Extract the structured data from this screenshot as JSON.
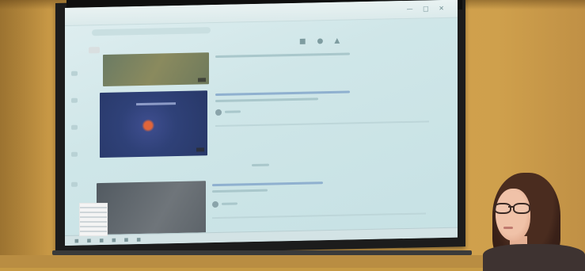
{
  "scene": {
    "description_colors": {
      "wall": "#c69a45",
      "screen_bg": "#cfe6e8",
      "frame": "#1c1c1c",
      "accent_title": "#5d7ea2"
    }
  },
  "browser": {
    "toolbar_icons": [
      "minimize-icon",
      "maximize-icon",
      "close-icon"
    ],
    "video_list": [
      {
        "thumb_style": "landscape",
        "title": "",
        "meta": ""
      },
      {
        "thumb_style": "space-orb",
        "title": "",
        "meta": ""
      },
      {
        "thumb_style": "open-book",
        "title": "",
        "meta": ""
      }
    ]
  },
  "icons": {
    "browser_window_controls": "window-controls-icon",
    "search": "search-icon"
  }
}
